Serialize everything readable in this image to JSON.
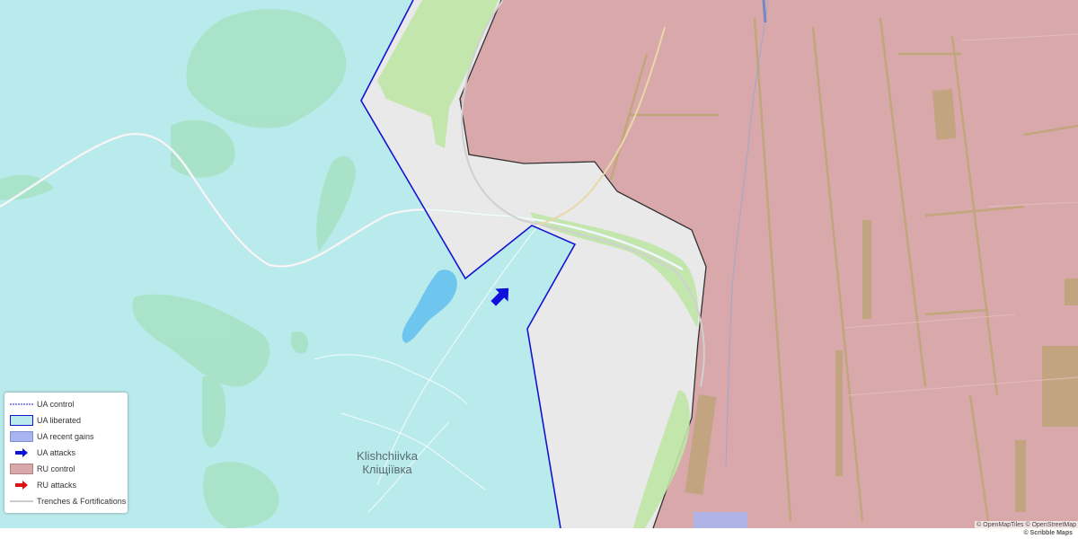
{
  "colors": {
    "ua_liberated_fill": "#b9eaec",
    "ua_border": "#1414d0",
    "ru_fill": "#d8a8aa",
    "ru_border": "#333333",
    "neutral": "#e9e9e9",
    "vegetation": "#a8e3a8",
    "water": "#6ec6ef",
    "arrow_ua": "#1010dd",
    "arrow_ru": "#e01010",
    "recent_gains": "#a8b4f0",
    "trench": "#999999"
  },
  "map_labels": {
    "town_latin": "Klishchiivka",
    "town_cyrillic": "Кліщіївка"
  },
  "legend": {
    "ua_control": "UA control",
    "ua_liberated": "UA liberated",
    "ua_recent_gains": "UA recent gains",
    "ua_attacks": "UA attacks",
    "ru_control": "RU control",
    "ru_attacks": "RU attacks",
    "trenches": "Trenches & Fortifications"
  },
  "attribution": "© OpenMapTiles © OpenStreetMap",
  "brand": "© Scribble Maps",
  "icons": {
    "ua_attack_arrow": "arrow-up-right-icon",
    "legend_ua_arrow": "arrow-right-blue-icon",
    "legend_ru_arrow": "arrow-right-red-icon"
  }
}
